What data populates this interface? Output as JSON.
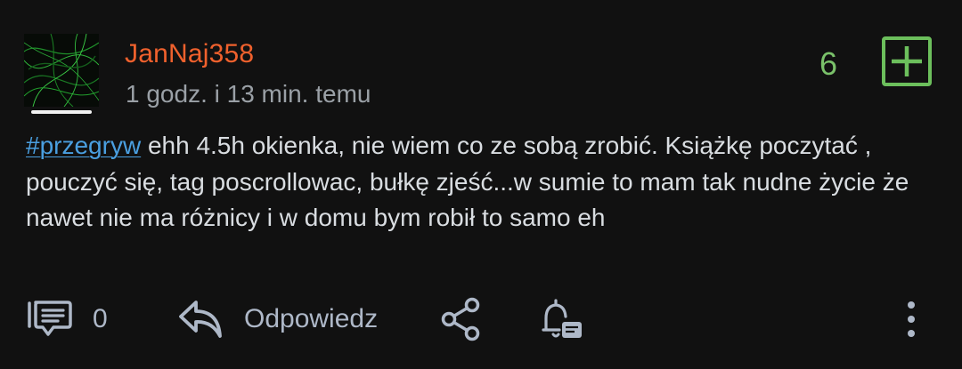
{
  "post": {
    "author": "JanNaj358",
    "timestamp": "1 godz. i 13 min. temu",
    "votes": "6",
    "tag": "#przegryw",
    "body": " ehh 4.5h okienka, nie wiem co ze sobą zrobić. Książkę poczytać , pouczyć się, tag poscrollowac, bułkę zjeść...w sumie to mam tak nudne życie że nawet nie ma różnicy i w domu bym robił to samo eh"
  },
  "actions": {
    "comments_count": "0",
    "reply_label": "Odpowiedz"
  },
  "icons": {
    "comments": "comments-icon",
    "reply": "reply-icon",
    "share": "share-icon",
    "notify": "bell-icon",
    "more": "more-vertical-icon",
    "plus": "plus-icon"
  },
  "colors": {
    "background": "#111111",
    "author": "#f0612d",
    "vote": "#6cbf5c",
    "tag": "#4a9fe0",
    "text": "#d9dde1",
    "muted": "#9aa0a6",
    "action": "#aeb8c8"
  }
}
